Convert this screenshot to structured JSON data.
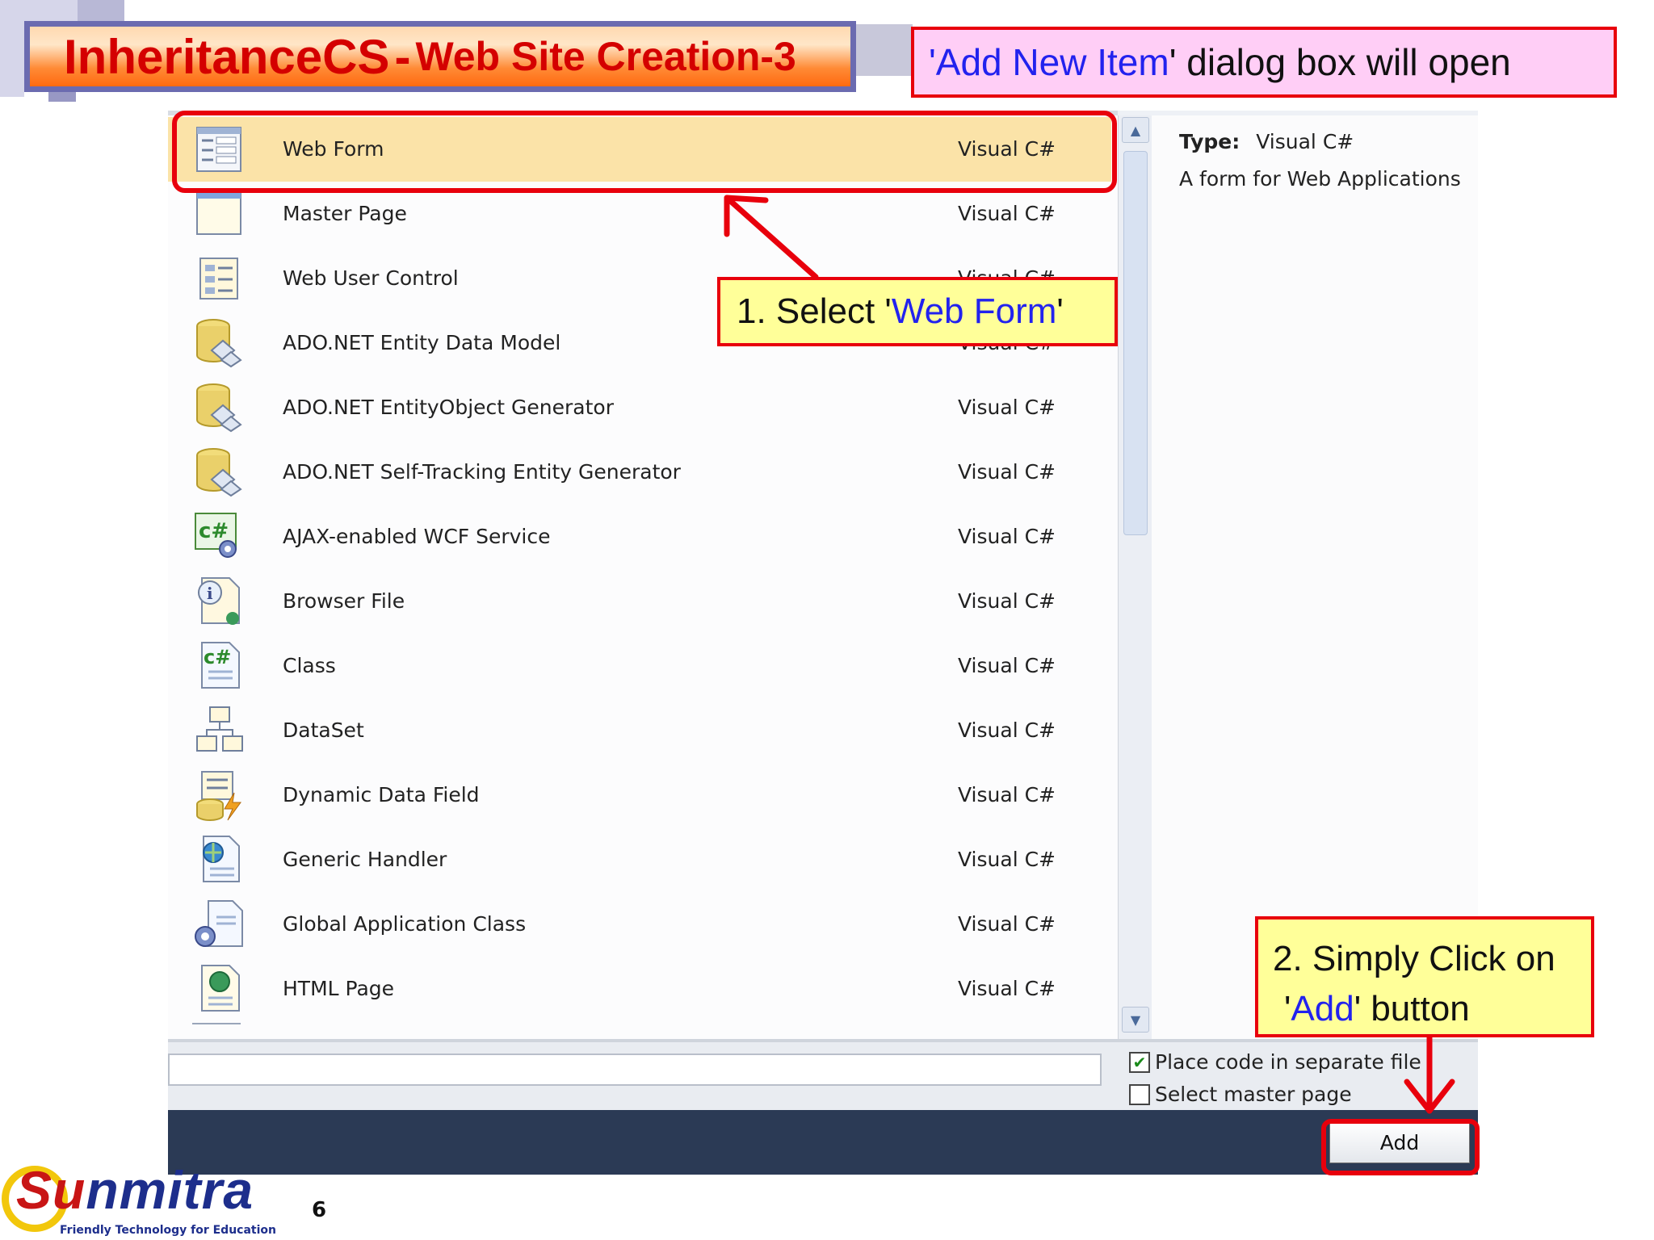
{
  "slide": {
    "title_main": "InheritanceCS",
    "title_separator": "-",
    "title_sub": "Web Site Creation-3",
    "caption_quote_open": "'",
    "caption_highlight": "Add New Item",
    "caption_rest": "' dialog box will open",
    "page_number": "6"
  },
  "dialog": {
    "items": [
      {
        "name": "Web Form",
        "type": "Visual C#",
        "icon": "web-form-icon"
      },
      {
        "name": "Master Page",
        "type": "Visual C#",
        "icon": "master-page-icon"
      },
      {
        "name": "Web User Control",
        "type": "Visual C#",
        "icon": "web-user-control-icon"
      },
      {
        "name": "ADO.NET Entity Data Model",
        "type": "Visual C#",
        "icon": "database-icon"
      },
      {
        "name": "ADO.NET EntityObject Generator",
        "type": "Visual C#",
        "icon": "database-icon"
      },
      {
        "name": "ADO.NET Self-Tracking Entity Generator",
        "type": "Visual C#",
        "icon": "database-icon"
      },
      {
        "name": "AJAX-enabled WCF Service",
        "type": "Visual C#",
        "icon": "wcf-service-icon"
      },
      {
        "name": "Browser File",
        "type": "Visual C#",
        "icon": "browser-file-icon"
      },
      {
        "name": "Class",
        "type": "Visual C#",
        "icon": "class-file-icon"
      },
      {
        "name": "DataSet",
        "type": "Visual C#",
        "icon": "dataset-icon"
      },
      {
        "name": "Dynamic Data Field",
        "type": "Visual C#",
        "icon": "dynamic-data-field-icon"
      },
      {
        "name": "Generic Handler",
        "type": "Visual C#",
        "icon": "generic-handler-icon"
      },
      {
        "name": "Global Application Class",
        "type": "Visual C#",
        "icon": "global-app-class-icon"
      },
      {
        "name": "HTML Page",
        "type": "Visual C#",
        "icon": "html-page-icon"
      }
    ],
    "selected_index": 0,
    "description": {
      "type_label": "Type:",
      "type_value": "Visual C#",
      "text": "A form for Web Applications"
    },
    "options": {
      "separate_file_label": "Place code in separate file",
      "separate_file_checked": true,
      "master_page_label": "Select master page",
      "master_page_checked": false
    },
    "add_button_label": "Add"
  },
  "callouts": {
    "select": {
      "prefix": "1. Select '",
      "highlight": "Web Form",
      "suffix": "'"
    },
    "add": {
      "line1": "2. Simply Click on",
      "prefix": "'",
      "highlight": "Add",
      "suffix": "' button"
    }
  },
  "logo": {
    "brand_su": "Su",
    "brand_rest": "nmitra",
    "tagline": "Friendly Technology for Education"
  },
  "colors": {
    "title_text": "#d40000",
    "highlight_blue": "#2222ee",
    "callout_border": "#e8000c",
    "callout_bg": "#ffff99",
    "caption_bg": "#ffcef6",
    "selected_row": "#fbe3a8",
    "footer_bar": "#2b3a55"
  }
}
